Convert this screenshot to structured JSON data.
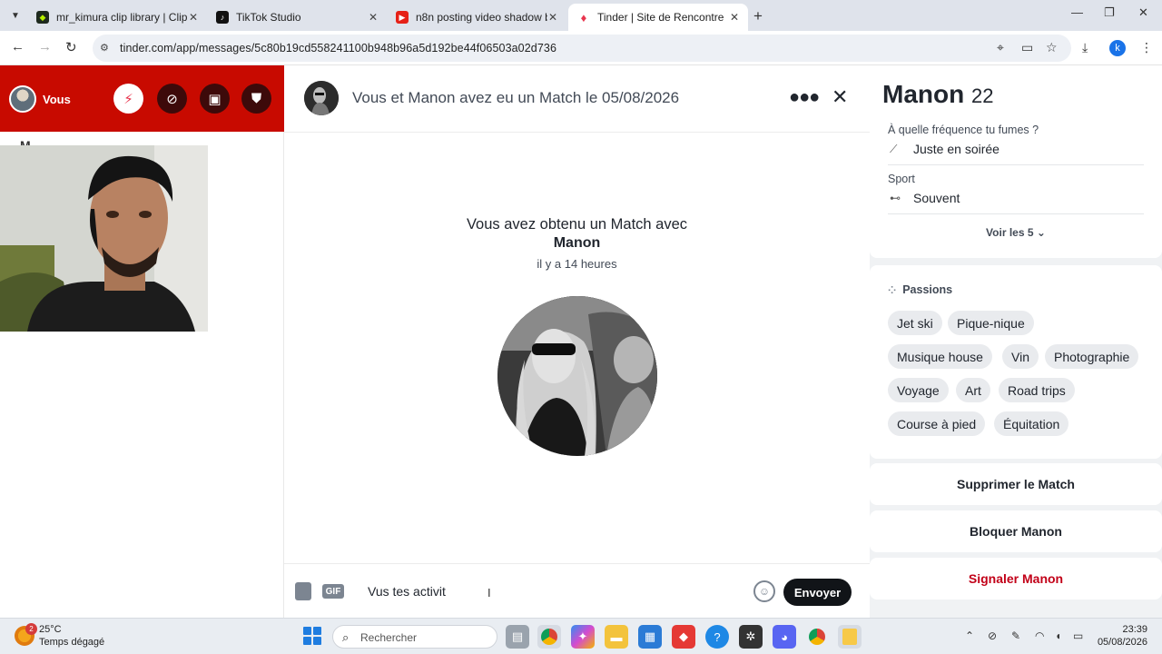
{
  "browser": {
    "tabs": [
      {
        "title": "mr_kimura clip library | ClipLabz",
        "active": false
      },
      {
        "title": "TikTok Studio",
        "active": false
      },
      {
        "title": "n8n posting video shadow ban",
        "active": false
      },
      {
        "title": "Tinder | Site de Rencontre",
        "active": true
      }
    ],
    "url": "tinder.com/app/messages/5c80b19cd558241100b948b96a5d192be44f06503a02d736",
    "profile_initial": "k"
  },
  "sidebar": {
    "user_label": "Vous",
    "peek_text": "M..."
  },
  "chat": {
    "header_title": "Vous et Manon avez eu un Match le 05/08/2026",
    "match_text": "Vous avez obtenu un Match avec",
    "match_name": "Manon",
    "match_time": "il y a 14 heures",
    "gif_label": "GIF",
    "message_value": "Vus tes activit",
    "send_label": "Envoyer"
  },
  "profile": {
    "name": "Manon",
    "age": "22",
    "q1": "À quelle fréquence tu fumes ?",
    "a1": "Juste en soirée",
    "q2": "Sport",
    "a2": "Souvent",
    "voir": "Voir les 5",
    "passions_title": "Passions",
    "passions": [
      "Jet ski",
      "Pique-nique",
      "Musique house",
      "Vin",
      "Photographie",
      "Voyage",
      "Art",
      "Road trips",
      "Course à pied",
      "Équitation"
    ],
    "actions": {
      "delete": "Supprimer le Match",
      "block": "Bloquer Manon",
      "report": "Signaler Manon"
    }
  },
  "taskbar": {
    "weather_badge": "2",
    "temperature": "25°C",
    "condition": "Temps dégagé",
    "search_placeholder": "Rechercher",
    "time": "23:39",
    "date": "05/08/2026"
  },
  "colors": {
    "tinder_red": "#c80a00",
    "report_red": "#c20018",
    "send_button": "#111418"
  }
}
